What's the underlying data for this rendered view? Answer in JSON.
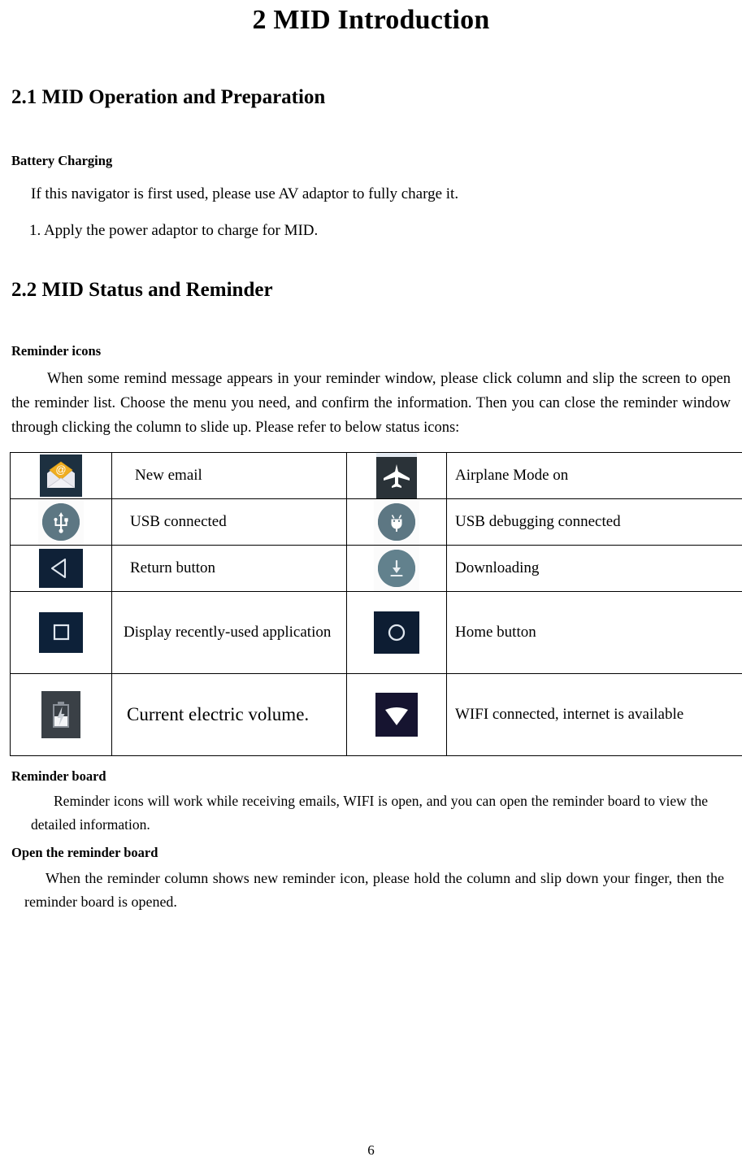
{
  "document": {
    "chapter_title": "2 MID Introduction",
    "page_number": "6"
  },
  "sections": {
    "operation": {
      "heading": "2.1 MID Operation and Preparation",
      "sub_heading": "Battery Charging",
      "paragraph_1": "If this navigator is first used, please use AV adaptor to fully charge it.",
      "paragraph_2": "1. Apply the power adaptor to charge for MID."
    },
    "status": {
      "heading": "2.2   MID Status and Reminder",
      "sub_heading": "Reminder icons",
      "intro": "When some remind message appears in your reminder window, please click column and slip the screen to open the reminder list. Choose the menu you need, and confirm the information. Then you can close the reminder window through clicking the column to slide up. Please refer to below status icons:"
    },
    "reminder_board": {
      "heading": "Reminder board",
      "paragraph": "Reminder icons will work while receiving emails, WIFI is open, and you can open the reminder board to view the detailed information."
    },
    "open_reminder_board": {
      "heading": "Open the reminder board",
      "paragraph": "When the reminder column shows new reminder icon, please hold the column and slip down your finger, then the reminder board is opened."
    }
  },
  "status_table": {
    "rows": [
      {
        "left": {
          "icon": "new-email-icon",
          "label": "New email"
        },
        "right": {
          "icon": "airplane-mode-icon",
          "label": "Airplane Mode on"
        }
      },
      {
        "left": {
          "icon": "usb-connected-icon",
          "label": "USB connected"
        },
        "right": {
          "icon": "usb-debugging-icon",
          "label": "USB debugging connected"
        }
      },
      {
        "left": {
          "icon": "return-button-icon",
          "label": "Return button"
        },
        "right": {
          "icon": "downloading-icon",
          "label": "Downloading"
        }
      },
      {
        "left": {
          "icon": "recent-apps-icon",
          "label": "Display recently-used application"
        },
        "right": {
          "icon": "home-button-icon",
          "label": "Home button"
        }
      },
      {
        "left": {
          "icon": "battery-charging-icon",
          "label": "Current electric volume."
        },
        "right": {
          "icon": "wifi-connected-icon",
          "label": "WIFI connected, internet is available"
        }
      }
    ]
  },
  "colors": {
    "email_bg": "#1d3040",
    "email_flap": "#f0ae21",
    "airplane_bg": "#2a3238",
    "circle_icon": "#5d7783",
    "nav_button_bg": "#0d2139",
    "battery_bg": "#3a4046",
    "wifi_bg": "#161430",
    "text": "#000000",
    "table_border": "#000000"
  }
}
